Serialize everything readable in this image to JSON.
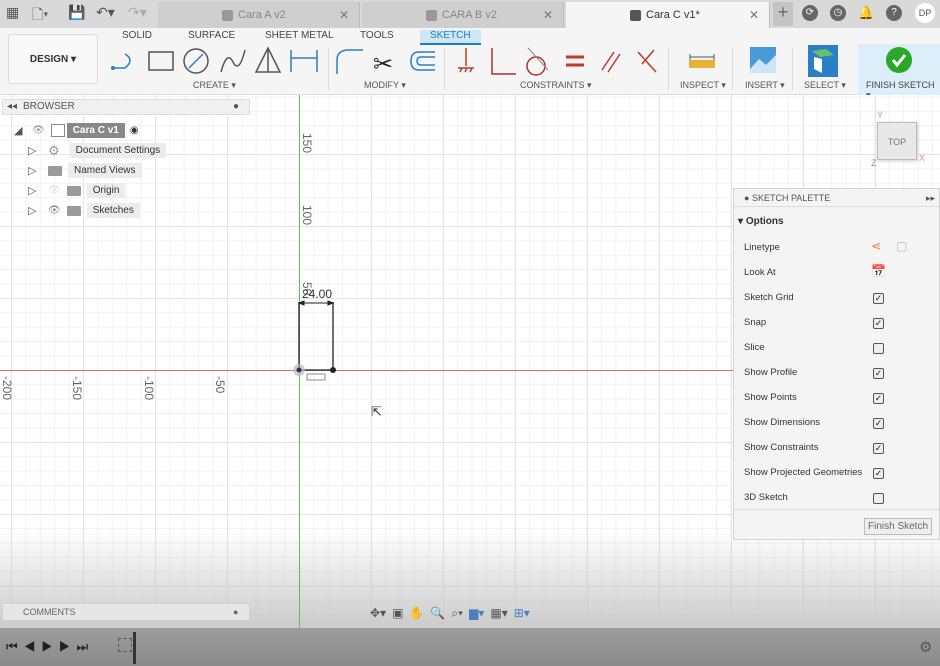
{
  "tabs": [
    {
      "label": "Cara A v2",
      "active": false
    },
    {
      "label": "CARA B v2",
      "active": false
    },
    {
      "label": "Cara C v1*",
      "active": true
    }
  ],
  "user_initials": "DP",
  "workspace": "DESIGN ▾",
  "ribbon_tabs": [
    "SOLID",
    "SURFACE",
    "SHEET METAL",
    "TOOLS",
    "SKETCH"
  ],
  "active_ribbon_tab": "SKETCH",
  "groups": {
    "create": "CREATE ▾",
    "modify": "MODIFY ▾",
    "constraints": "CONSTRAINTS ▾",
    "inspect": "INSPECT ▾",
    "insert": "INSERT ▾",
    "select": "SELECT ▾",
    "finish": "FINISH SKETCH ▾"
  },
  "browser": {
    "title": "BROWSER",
    "root": "Cara C v1",
    "items": [
      "Document Settings",
      "Named Views",
      "Origin",
      "Sketches"
    ]
  },
  "axis_labels": {
    "y": [
      "150",
      "100",
      "50"
    ],
    "x": [
      "-200",
      "-150",
      "-100",
      "-50"
    ]
  },
  "dimension": "24.00",
  "viewcube": {
    "face": "TOP",
    "x": "X",
    "y": "Y",
    "z": "Z"
  },
  "palette": {
    "title": "SKETCH PALETTE",
    "section": "Options",
    "rows": [
      {
        "label": "Linetype",
        "type": "icons"
      },
      {
        "label": "Look At",
        "type": "icon"
      },
      {
        "label": "Sketch Grid",
        "checked": true
      },
      {
        "label": "Snap",
        "checked": true
      },
      {
        "label": "Slice",
        "checked": false
      },
      {
        "label": "Show Profile",
        "checked": true
      },
      {
        "label": "Show Points",
        "checked": true
      },
      {
        "label": "Show Dimensions",
        "checked": true
      },
      {
        "label": "Show Constraints",
        "checked": true
      },
      {
        "label": "Show Projected Geometries",
        "checked": true
      },
      {
        "label": "3D Sketch",
        "checked": false
      }
    ],
    "finish_button": "Finish Sketch"
  },
  "comments": "COMMENTS",
  "colors": {
    "accent": "#1a7fc4",
    "x_axis": "#e07060",
    "y_axis": "#5cbf5c",
    "finish": "#2aa82a"
  }
}
